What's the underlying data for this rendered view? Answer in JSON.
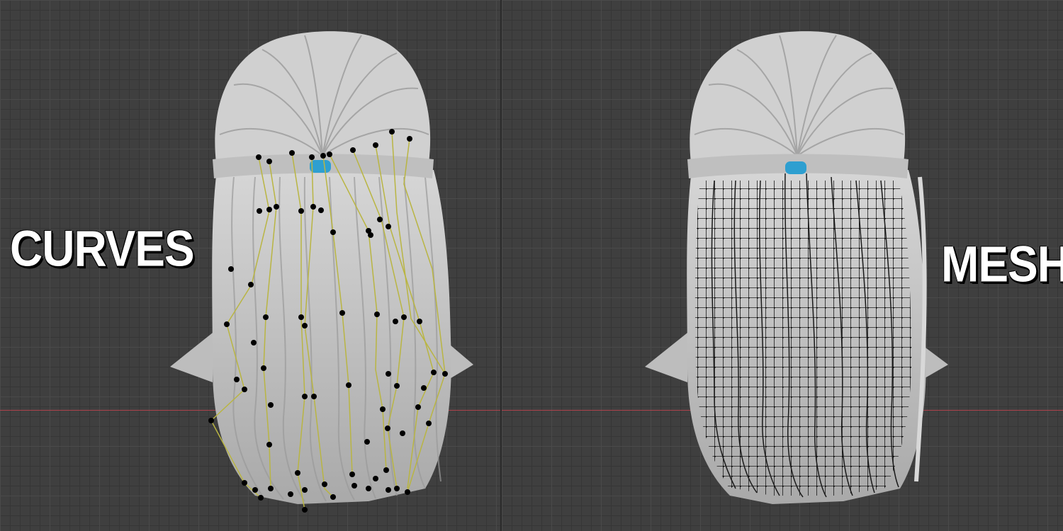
{
  "left_panel": {
    "label": "CURVES"
  },
  "right_panel": {
    "label": "MESH"
  },
  "colors": {
    "viewport_background": "#3f3f3f",
    "grid_line": "#4a4a4a",
    "x_axis": "#c0434f",
    "hair": "#c9c9c9",
    "hair_tie": "#2e9fd0",
    "curve_line": "#b9b542",
    "control_point": "#000000",
    "mesh_wire": "#111111"
  },
  "icons": {
    "left_model": "hair-model-curves",
    "right_model": "hair-model-mesh"
  }
}
